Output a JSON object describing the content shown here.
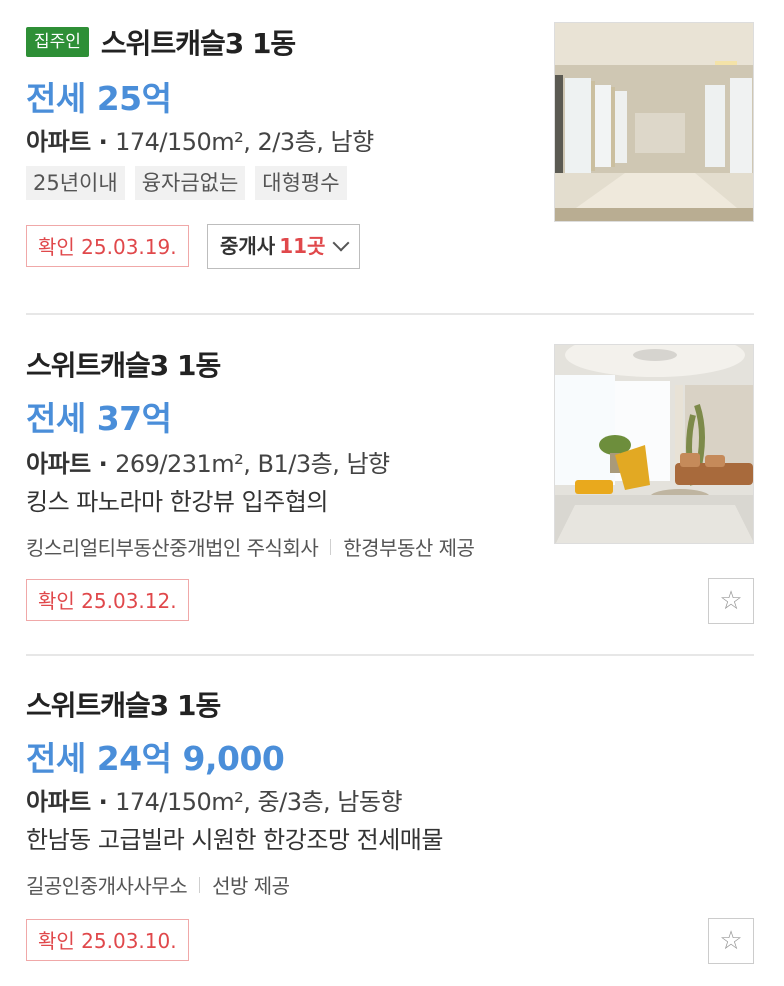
{
  "listings": [
    {
      "owner_badge": "집주인",
      "title": "스위트캐슬3 1동",
      "price": "전세 25억",
      "type": "아파트",
      "spec_dot": " · ",
      "spec": "174/150m², 2/3층, 남향",
      "tags": [
        "25년이내",
        "융자금없는",
        "대형평수"
      ],
      "confirm": "확인 25.03.19.",
      "agents_label": "중개사",
      "agents_count": "11곳",
      "photo_icon": "photo-interior-hallway"
    },
    {
      "title": "스위트캐슬3 1동",
      "price": "전세 37억",
      "type": "아파트",
      "spec_dot": " · ",
      "spec": "269/231m², B1/3층, 남향",
      "desc": "킹스 파노라마 한강뷰 입주협의",
      "agency": "킹스리얼티부동산중개법인 주식회사",
      "provider": "한경부동산 제공",
      "confirm": "확인 25.03.12.",
      "photo_icon": "photo-living-room",
      "fav_icon": "star-outline-icon"
    },
    {
      "title": "스위트캐슬3 1동",
      "price": "전세 24억 9,000",
      "type": "아파트",
      "spec_dot": " · ",
      "spec": "174/150m², 중/3층, 남동향",
      "desc": "한남동 고급빌라 시원한 한강조망 전세매물",
      "agency": "길공인중개사사무소",
      "provider": "선방 제공",
      "confirm": "확인 25.03.10.",
      "fav_icon": "star-outline-icon"
    }
  ],
  "colors": {
    "price_blue": "#4a8ed9",
    "confirm_red": "#e0484b",
    "owner_green": "#2e8f36"
  }
}
